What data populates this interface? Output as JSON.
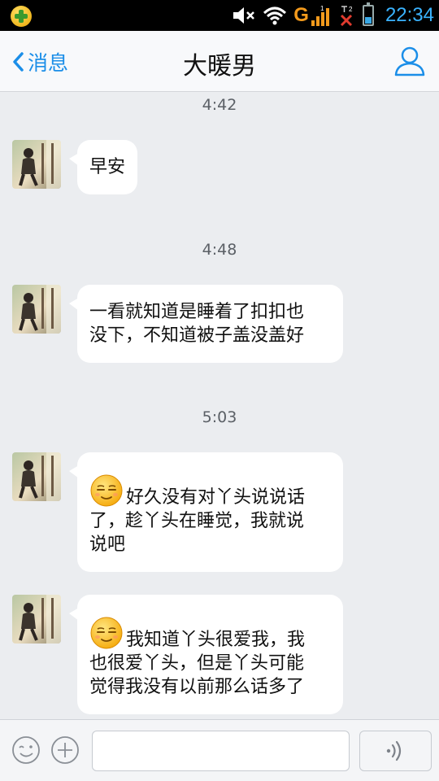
{
  "status_bar": {
    "time": "22:34",
    "icons": [
      "app-notification-icon",
      "mute-icon",
      "wifi-icon",
      "g-network-icon",
      "signal-1-icon",
      "signal-2-no-service-icon",
      "battery-icon"
    ],
    "network_label": "G",
    "sim1_label": "1",
    "sim2_label": "2",
    "battery_level": 0.4,
    "colors": {
      "time": "#3ab3ff",
      "network": "#f39a1c",
      "no_service": "#e23b2e"
    }
  },
  "header": {
    "back_label": "消息",
    "title": "大暖男",
    "right_icon": "profile-icon",
    "accent": "#1b8ee8"
  },
  "messages": [
    {
      "time": "4:42",
      "lines": [
        "早安"
      ],
      "emoji": false
    },
    {
      "time": "4:48",
      "lines": [
        "一看就知道是睡着了扣扣也",
        "没下，不知道被子盖没盖好"
      ],
      "emoji": false
    },
    {
      "time": "5:03",
      "lines": [
        "好久没有对丫头说说话",
        "了，趁丫头在睡觉，我就说",
        "说吧"
      ],
      "emoji": true
    },
    {
      "time": "",
      "lines": [
        "我知道丫头很爱我，我",
        "也很爱丫头，但是丫头可能",
        "觉得我没有以前那么话多了"
      ],
      "emoji": true
    }
  ],
  "input_bar": {
    "icons": [
      "emoji-icon",
      "plus-icon",
      "voice-icon"
    ],
    "input_value": "",
    "input_placeholder": ""
  }
}
